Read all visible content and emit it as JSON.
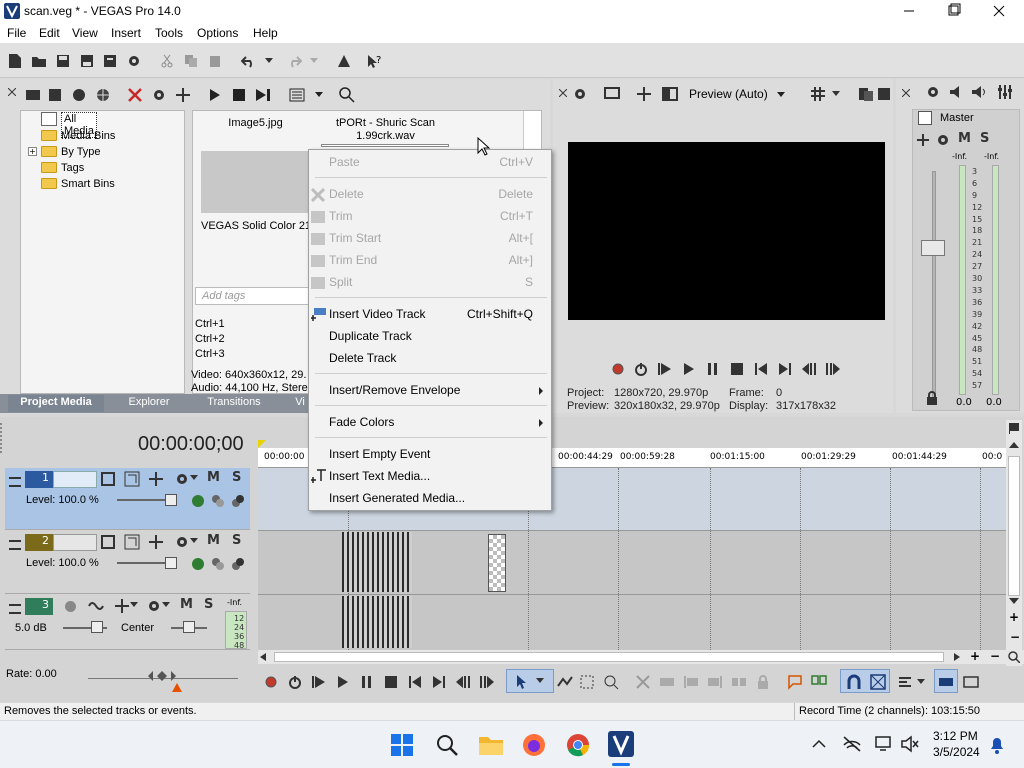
{
  "window": {
    "title": "scan.veg * - VEGAS Pro 14.0",
    "controls": {
      "minimize": "minimize-icon",
      "maximize": "maximize-icon",
      "close": "close-icon"
    }
  },
  "menu": [
    "File",
    "Edit",
    "View",
    "Insert",
    "Tools",
    "Options",
    "Help"
  ],
  "project_media": {
    "tree": [
      "All Media",
      "Media Bins",
      "By Type",
      "Tags",
      "Smart Bins"
    ],
    "tree_expand": "+",
    "items": [
      {
        "name": "Image5.jpg"
      },
      {
        "name": "tPORt - Shuric Scan 1.99crk.wav"
      },
      {
        "name": "VEGAS Solid Color 21"
      }
    ],
    "tags_placeholder": "Add tags",
    "shortcuts": [
      "Ctrl+1",
      "Ctrl+2",
      "Ctrl+3"
    ],
    "info_video": "Video: 640x360x12, 29.",
    "info_audio": "Audio: 44,100 Hz, Stere",
    "tabs": [
      "Project Media",
      "Explorer",
      "Transitions",
      "Vi"
    ]
  },
  "preview": {
    "mode": "Preview (Auto)",
    "project_label": "Project:",
    "project_value": "1280x720, 29.970p",
    "preview_label": "Preview:",
    "preview_value": "320x180x32, 29.970p",
    "frame_label": "Frame:",
    "frame_value": "0",
    "display_label": "Display:",
    "display_value": "317x178x32"
  },
  "master": {
    "label": "Master",
    "m": "M",
    "s": "S",
    "inf_left": "-Inf.",
    "inf_right": "-Inf.",
    "scale": [
      "3",
      "6",
      "9",
      "12",
      "15",
      "18",
      "21",
      "24",
      "27",
      "30",
      "33",
      "36",
      "39",
      "42",
      "45",
      "48",
      "51",
      "54",
      "57"
    ],
    "bottom_left": "0.0",
    "bottom_right": "0.0"
  },
  "timeline": {
    "timecode": "00:00:00;00",
    "ruler": [
      "00:00:00",
      "00:00:44:29",
      "00:00:59:28",
      "00:01:15:00",
      "00:01:29:29",
      "00:01:44:29",
      "00:0"
    ],
    "tracks": [
      {
        "number": "1",
        "type": "video",
        "level": "Level: 100.0 %",
        "m": "M",
        "s": "S"
      },
      {
        "number": "2",
        "type": "video",
        "level": "Level: 100.0 %",
        "m": "M",
        "s": "S"
      },
      {
        "number": "3",
        "type": "audio",
        "volume": "5.0 dB",
        "pan": "Center",
        "m": "M",
        "s": "S",
        "inf": "-Inf.",
        "meter": [
          "12",
          "24",
          "36",
          "48"
        ]
      }
    ],
    "rate": "Rate: 0.00"
  },
  "context_menu": {
    "items": [
      {
        "label": "Paste",
        "shortcut": "Ctrl+V",
        "disabled": true
      },
      {
        "label": "Delete",
        "shortcut": "Delete",
        "disabled": true
      },
      {
        "label": "Trim",
        "shortcut": "Ctrl+T",
        "disabled": true
      },
      {
        "label": "Trim Start",
        "shortcut": "Alt+[",
        "disabled": true
      },
      {
        "label": "Trim End",
        "shortcut": "Alt+]",
        "disabled": true
      },
      {
        "label": "Split",
        "shortcut": "S",
        "disabled": true
      },
      {
        "label": "Insert Video Track",
        "shortcut": "Ctrl+Shift+Q",
        "disabled": false
      },
      {
        "label": "Duplicate Track",
        "shortcut": "",
        "disabled": false
      },
      {
        "label": "Delete Track",
        "shortcut": "",
        "disabled": false
      },
      {
        "label": "Insert/Remove Envelope",
        "shortcut": "",
        "disabled": false,
        "submenu": true
      },
      {
        "label": "Fade Colors",
        "shortcut": "",
        "disabled": false,
        "submenu": true
      },
      {
        "label": "Insert Empty Event",
        "shortcut": "",
        "disabled": false
      },
      {
        "label": "Insert Text Media...",
        "shortcut": "",
        "disabled": false
      },
      {
        "label": "Insert Generated Media...",
        "shortcut": "",
        "disabled": false
      }
    ]
  },
  "status": {
    "message": "Removes the selected tracks or events.",
    "record_time": "Record Time (2 channels): 103:15:50"
  },
  "taskbar": {
    "time": "3:12 PM",
    "date": "3/5/2024",
    "apps": [
      "start-icon",
      "search-icon",
      "file-explorer-icon",
      "firefox-icon",
      "chrome-icon",
      "vegas-icon"
    ]
  },
  "colors": {
    "accent": "#3a73c8",
    "track_selected_bg": "#aac4e6",
    "preview_bg": "#000000",
    "tab_active_bg": "#7f8a96"
  }
}
